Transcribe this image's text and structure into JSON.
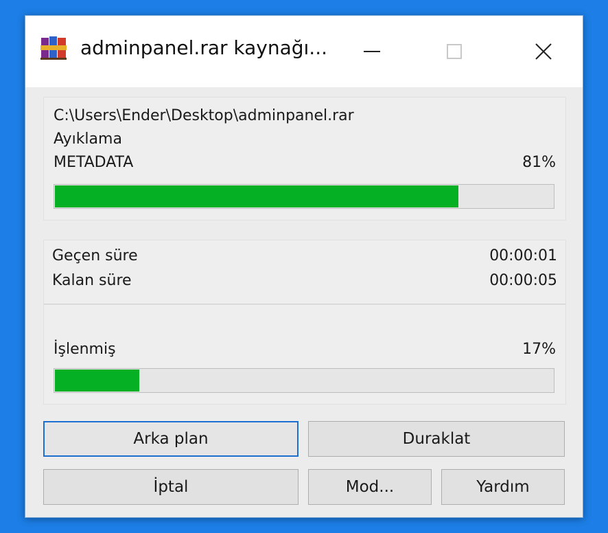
{
  "window": {
    "title": "adminpanel.rar kaynağı...",
    "icon": "winrar-books-icon",
    "controls": {
      "minimize": "minimize-icon",
      "maximize": "maximize-icon",
      "close": "close-icon"
    }
  },
  "extraction": {
    "archive_path": "C:\\Users\\Ender\\Desktop\\adminpanel.rar",
    "operation": "Ayıklama",
    "current_file": "METADATA",
    "file_percent_label": "81%",
    "file_progress": 0.81
  },
  "timing": {
    "elapsed_label": "Geçen süre",
    "elapsed_value": "00:00:01",
    "remaining_label": "Kalan süre",
    "remaining_value": "00:00:05"
  },
  "total": {
    "label": "İşlenmiş",
    "percent_label": "17%",
    "progress": 0.17
  },
  "buttons": {
    "background": "Arka plan",
    "pause": "Duraklat",
    "cancel": "İptal",
    "mode": "Mod...",
    "help": "Yardım"
  },
  "colors": {
    "progress_fill": "#06b025",
    "desktop": "#1c7ee6",
    "default_button_border": "#1c6fd1"
  }
}
